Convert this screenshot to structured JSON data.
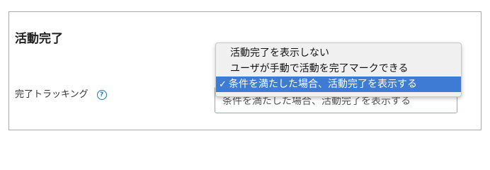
{
  "section": {
    "title": "活動完了"
  },
  "field": {
    "label": "完了トラッキング",
    "help_icon": "question-circle-icon",
    "help_glyph": "?"
  },
  "select": {
    "current_value": "条件を満たした場合、活動完了を表示する"
  },
  "dropdown": {
    "options": [
      {
        "label": "活動完了を表示しない",
        "selected": false
      },
      {
        "label": "ユーザが手動で活動を完了マークできる",
        "selected": false
      },
      {
        "label": "条件を満たした場合、活動完了を表示する",
        "selected": true
      }
    ],
    "check_glyph": "✓"
  },
  "colors": {
    "accent": "#1a76c8",
    "selected_option_bg": "#3d7bd4",
    "frame_border": "#a9a9a9"
  }
}
